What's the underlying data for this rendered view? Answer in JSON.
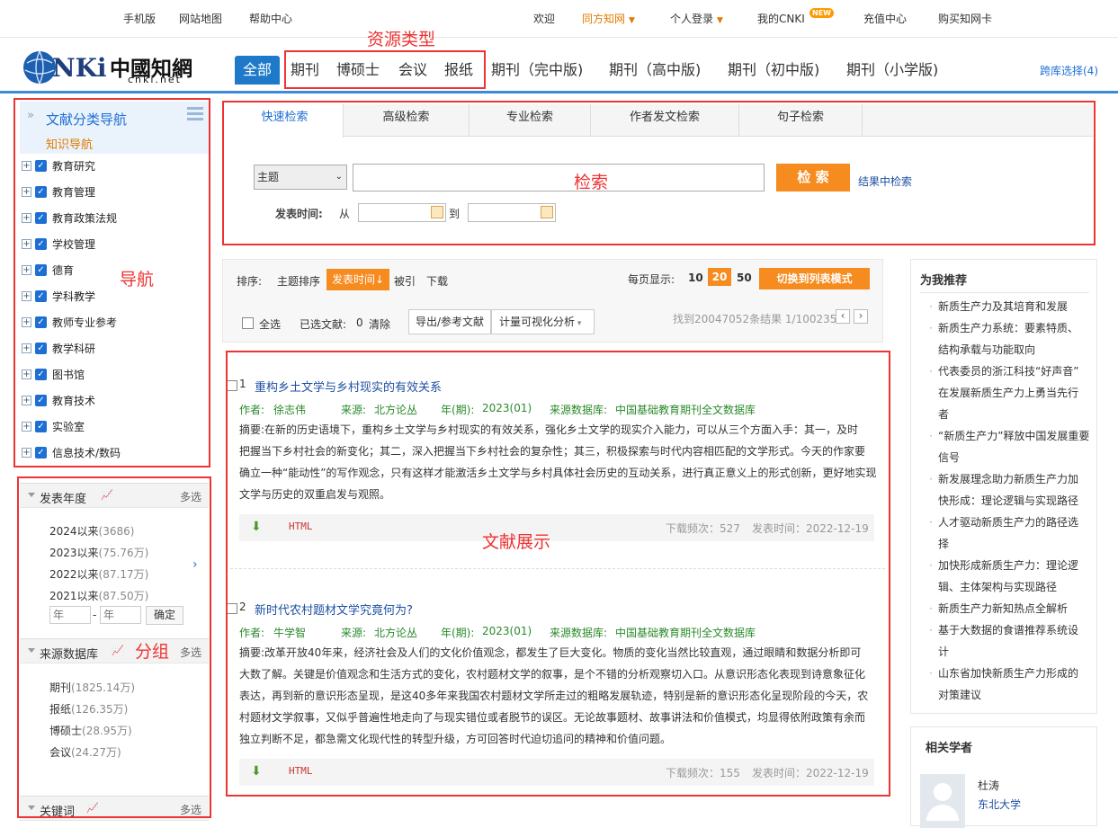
{
  "topbar": {
    "links": [
      "手机版",
      "网站地图",
      "帮助中心"
    ],
    "welcome": "欢迎",
    "fangfang": "同方知网",
    "login": "个人登录",
    "mycnki": "我的CNKI",
    "new_badge": "NEW",
    "recharge": "充值中心",
    "buycard": "购买知网卡"
  },
  "logo": {
    "text_main": "CNKi中国知网",
    "text_sub": "cnki.net"
  },
  "tabs": [
    "全部",
    "期刊",
    "博硕士",
    "会议",
    "报纸",
    "期刊（完中版)",
    "期刊（高中版)",
    "期刊（初中版)",
    "期刊（小学版)"
  ],
  "cross_db": "跨库选择(4)",
  "annotations": {
    "resource_type": "资源类型",
    "search": "检索",
    "nav": "导航",
    "group": "分组",
    "doc_display": "文献展示"
  },
  "sidebar": {
    "title": "文献分类导航",
    "subtitle": "知识导航",
    "items": [
      "教育研究",
      "教育管理",
      "教育政策法规",
      "学校管理",
      "德育",
      "学科教学",
      "教师专业参考",
      "教学科研",
      "图书馆",
      "教育技术",
      "实验室",
      "信息技术/数码"
    ]
  },
  "groups": {
    "year": {
      "title": "发表年度",
      "multi": "多选",
      "items": [
        {
          "label": "2024以来",
          "count": "(3686)"
        },
        {
          "label": "2023以来",
          "count": "(75.76万)"
        },
        {
          "label": "2022以来",
          "count": "(87.17万)"
        },
        {
          "label": "2021以来",
          "count": "(87.50万)"
        }
      ],
      "from_placeholder": "年",
      "to_placeholder": "年",
      "dash": "-",
      "confirm": "确定"
    },
    "source": {
      "title": "来源数据库",
      "multi": "多选",
      "items": [
        {
          "label": "期刊",
          "count": "(1825.14万)"
        },
        {
          "label": "报纸",
          "count": "(126.35万)"
        },
        {
          "label": "博硕士",
          "count": "(28.95万)"
        },
        {
          "label": "会议",
          "count": "(24.27万)"
        }
      ]
    },
    "keyword": {
      "title": "关键词",
      "multi": "多选"
    }
  },
  "search": {
    "tabs": [
      "快速检索",
      "高级检索",
      "专业检索",
      "作者发文检索",
      "句子检索"
    ],
    "field": "主题",
    "button": "检 索",
    "within": "结果中检索",
    "date_label": "发表时间:",
    "from": "从",
    "to": "到"
  },
  "toolbar": {
    "sort_label": "排序:",
    "sort_options": [
      "主题排序",
      "发表时间↓",
      "被引",
      "下载"
    ],
    "per_page_label": "每页显示:",
    "per_page": [
      "10",
      "20",
      "50"
    ],
    "switch_mode": "切换到列表模式",
    "select_all": "全选",
    "selected_label": "已选文献:",
    "selected_count": "0",
    "clear": "清除",
    "export": "导出/参考文献",
    "visualize": "计量可视化分析",
    "result_info": "找到20047052条结果 1/1002353"
  },
  "results": [
    {
      "index": "1",
      "title": "重构乡土文学与乡村现实的有效关系",
      "author_label": "作者:",
      "author": "徐志伟",
      "source_label": "来源:",
      "source": "北方论丛",
      "period_label": "年(期):",
      "period": "2023(01)",
      "db_label": "来源数据库:",
      "db": "中国基础教育期刊全文数据库",
      "abstract_label": "摘要:",
      "abstract_lines": [
        "在新的历史语境下，重构乡土文学与乡村现实的有效关系，强化乡土文学的现实介入能力，可以从三个方面入手：其一，及时",
        "把握当下乡村社会的新变化；其二，深入把握当下乡村社会的复杂性；其三，积极探索与时代内容相匹配的文学形式。今天的作家要",
        "确立一种“能动性”的写作观念，只有这样才能激活乡土文学与乡村具体社会历史的互动关系，进行真正意义上的形式创新，更好地实现",
        "文学与历史的双重启发与观照。"
      ],
      "html": "HTML",
      "downloads": "下载频次：527",
      "date": "发表时间：2022-12-19"
    },
    {
      "index": "2",
      "title": "新时代农村题材文学究竟何为?",
      "author_label": "作者:",
      "author": "牛学智",
      "source_label": "来源:",
      "source": "北方论丛",
      "period_label": "年(期):",
      "period": "2023(01)",
      "db_label": "来源数据库:",
      "db": "中国基础教育期刊全文数据库",
      "abstract_label": "摘要:",
      "abstract_lines": [
        "改革开放40年来，经济社会及人们的文化价值观念，都发生了巨大变化。物质的变化当然比较直观，通过眼睛和数据分析即可",
        "大数了解。关键是价值观念和生活方式的变化，农村题材文学的叙事，是个不错的分析观察切入口。从意识形态化表现到诗意象征化",
        "表达，再到新的意识形态呈现，是这40多年来我国农村题材文学所走过的粗略发展轨迹，特别是新的意识形态化呈现阶段的今天，农",
        "村题材文学叙事，又似乎普遍性地走向了与现实错位或者脱节的误区。无论故事题材、故事讲法和价值模式，均显得依附政策有余而",
        "独立判断不足，都急需文化现代性的转型升级，方可回答时代迫切追问的精神和价值问题。"
      ],
      "html": "HTML",
      "downloads": "下载频次：155",
      "date": "发表时间：2022-12-19"
    }
  ],
  "recommend": {
    "title": "为我推荐",
    "items": [
      [
        "新质生产力及其培育和发展"
      ],
      [
        "新质生产力系统：要素特质、",
        "结构承载与功能取向"
      ],
      [
        "代表委员的浙江科技“好声音”",
        "在发展新质生产力上勇当先行",
        "者"
      ],
      [
        "“新质生产力”释放中国发展重要",
        "信号"
      ],
      [
        "新发展理念助力新质生产力加",
        "快形成：理论逻辑与实现路径"
      ],
      [
        "人才驱动新质生产力的路径选",
        "择"
      ],
      [
        "加快形成新质生产力：理论逻",
        "辑、主体架构与实现路径"
      ],
      [
        "新质生产力新知热点全解析"
      ],
      [
        "基于大数据的食谱推荐系统设",
        "计"
      ],
      [
        "山东省加快新质生产力形成的",
        "对策建议"
      ]
    ]
  },
  "scholars": {
    "title": "相关学者",
    "name": "杜涛",
    "org": "东北大学"
  },
  "colors": {
    "accent": "#1e7ac9",
    "orange": "#f68b1f",
    "annotation": "#e33333",
    "meta_green": "#2a8a2a"
  }
}
